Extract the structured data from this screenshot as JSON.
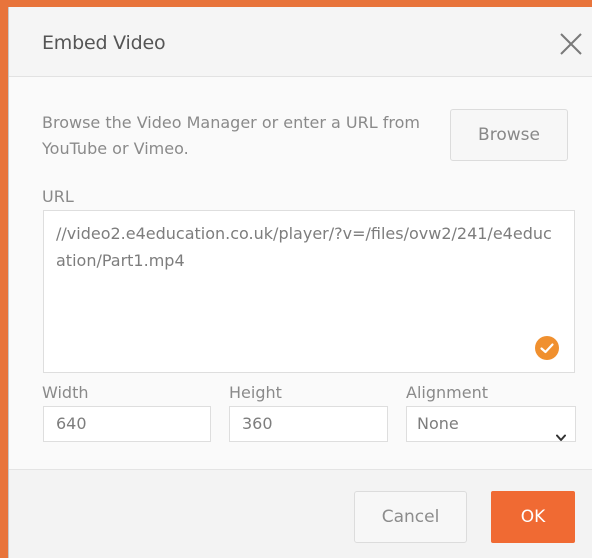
{
  "dialog": {
    "title": "Embed Video",
    "close_icon": "close-icon"
  },
  "help_text": "Browse the Video Manager or enter a URL from YouTube or Vimeo.",
  "browse_label": "Browse",
  "url": {
    "label": "URL",
    "value": "//video2.e4education.co.uk/player/?v=/files/ovw2/241/e4education/Part1.mp4",
    "valid_icon": "check-circle-icon"
  },
  "width": {
    "label": "Width",
    "value": "640"
  },
  "height": {
    "label": "Height",
    "value": "360"
  },
  "alignment": {
    "label": "Alignment",
    "value": "None",
    "caret_icon": "chevron-down-icon"
  },
  "footer": {
    "cancel_label": "Cancel",
    "ok_label": "OK"
  },
  "colors": {
    "accent": "#f06a33",
    "border_orange": "#e8743b",
    "valid_orange": "#f0902f"
  }
}
